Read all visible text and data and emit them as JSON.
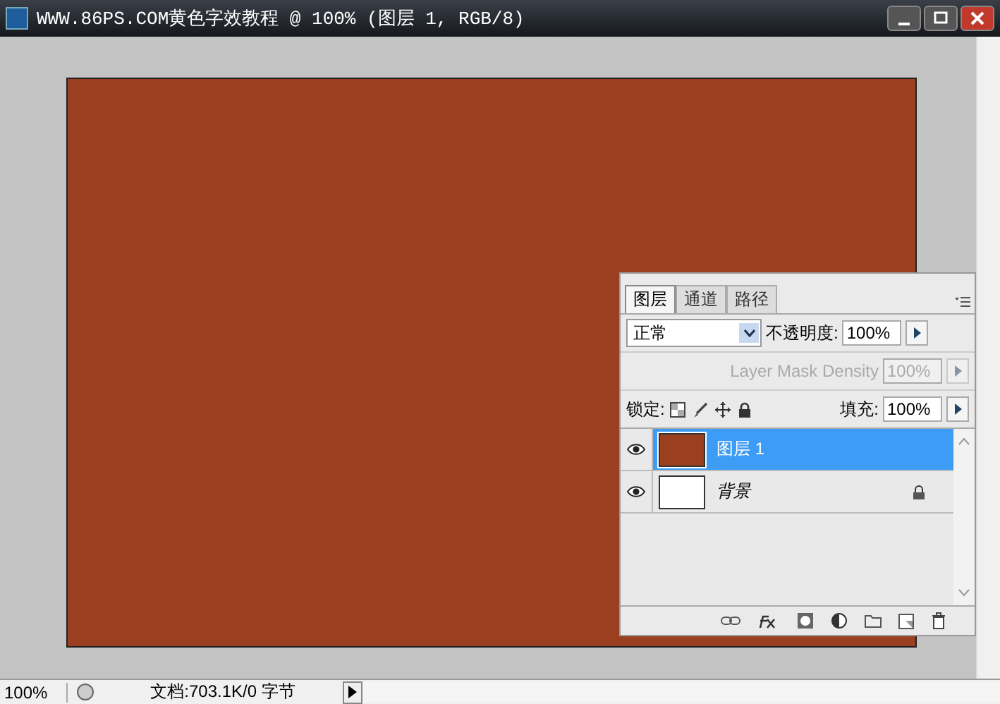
{
  "window": {
    "title": "WWW.86PS.COM黄色字效教程 @ 100% (图层 1, RGB/8)"
  },
  "layers_panel": {
    "tabs": [
      {
        "label": "图层",
        "selected": true
      },
      {
        "label": "通道",
        "selected": false
      },
      {
        "label": "路径",
        "selected": false
      }
    ],
    "blend_mode": "正常",
    "opacity_label": "不透明度:",
    "opacity": "100%",
    "mask_density_label": "Layer Mask Density",
    "mask_density": "100%",
    "mask_density_disabled": true,
    "lock_label": "锁定:",
    "fill_label": "填充:",
    "fill": "100%",
    "layers": [
      {
        "name": "图层 1",
        "selected": true,
        "visible": true,
        "locked": false,
        "color": "#9a3f1f"
      },
      {
        "name": "背景",
        "selected": false,
        "visible": true,
        "locked": true,
        "color": "#ffffff"
      }
    ]
  },
  "status_bar": {
    "zoom": "100%",
    "document": "文档:703.1K/0 字节"
  }
}
